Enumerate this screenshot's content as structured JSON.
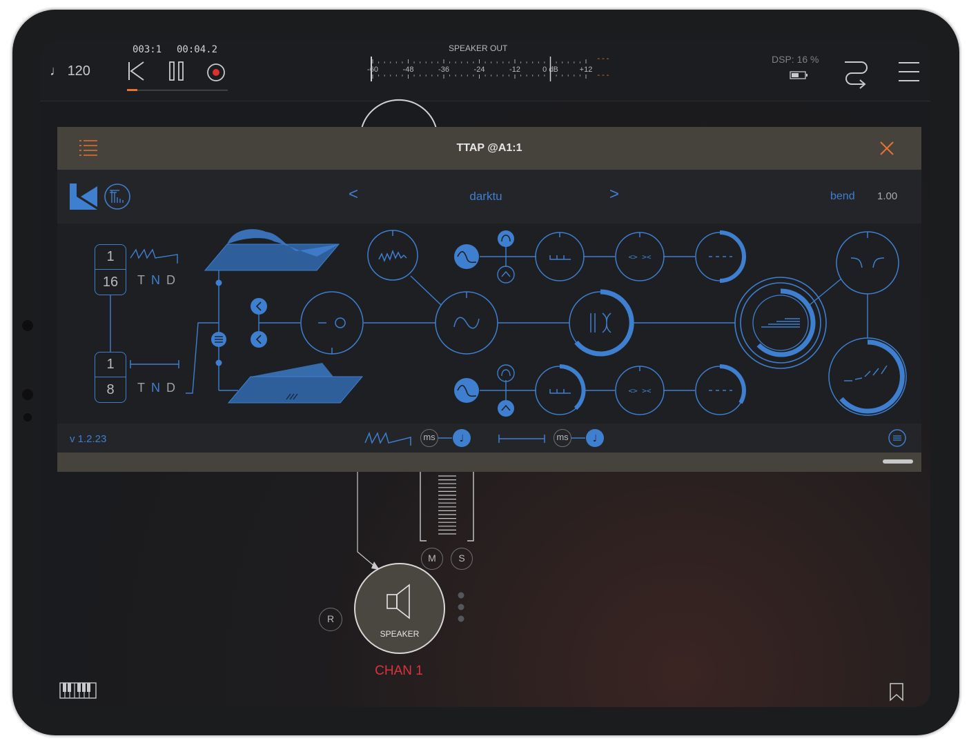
{
  "transport": {
    "tempo": "120",
    "bar_position": "003:1",
    "time_position": "00:04.2"
  },
  "meter": {
    "title": "SPEAKER OUT",
    "scale": [
      "-60",
      "-48",
      "-36",
      "-24",
      "-12",
      "0 dB",
      "+12"
    ],
    "peak_left": "---",
    "peak_right": "---"
  },
  "dsp": {
    "label": "DSP: 16 %"
  },
  "plugin": {
    "title": "TTAP @A1:1",
    "preset": "darktu",
    "prev_label": "<",
    "next_label": ">",
    "param_name": "bend",
    "param_value": "1.00",
    "version": "v 1.2.23",
    "tap1": {
      "numerator": "1",
      "denominator": "16",
      "modes": [
        "T",
        "N",
        "D"
      ]
    },
    "tap2": {
      "numerator": "1",
      "denominator": "8",
      "modes": [
        "T",
        "N",
        "D"
      ]
    },
    "footer_unit_ms": "ms"
  },
  "mixer": {
    "mute_label": "M",
    "solo_label": "S",
    "record_label": "R",
    "output_label": "SPEAKER",
    "channel_label": "CHAN 1"
  },
  "colors": {
    "accent_orange": "#e8732f",
    "plugin_blue": "#3f7fd0",
    "record_red": "#e0302d",
    "channel_red": "#d9343c"
  }
}
